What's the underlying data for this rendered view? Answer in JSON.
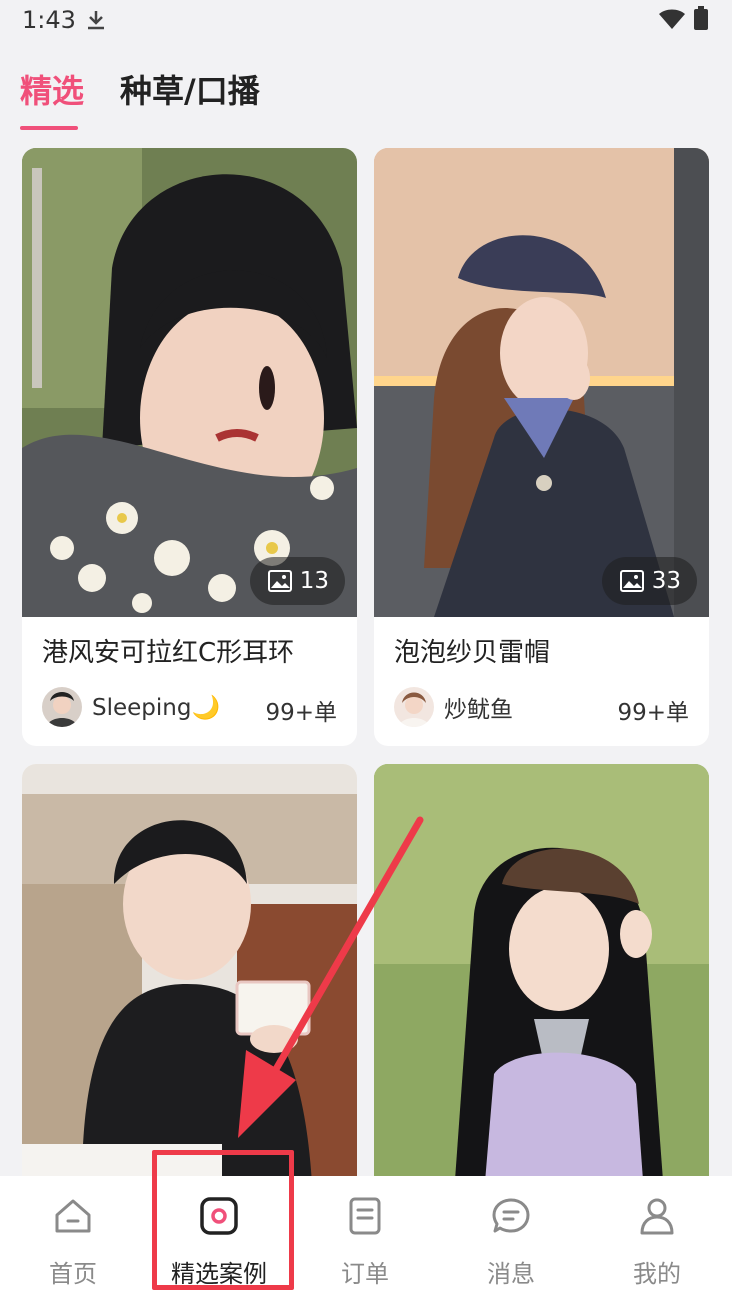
{
  "status_bar": {
    "time": "1:43"
  },
  "tabs": [
    {
      "label": "精选",
      "active": true
    },
    {
      "label": "种草/口播",
      "active": false
    }
  ],
  "cards": [
    {
      "title": "港风安可拉红C形耳环",
      "author": "Sleeping🌙",
      "orders": "99+单",
      "photo_count": "13"
    },
    {
      "title": "泡泡纱贝雷帽",
      "author": "炒鱿鱼",
      "orders": "99+单",
      "photo_count": "33"
    },
    {
      "title": "",
      "author": "",
      "orders": "",
      "photo_count": ""
    },
    {
      "title": "",
      "author": "",
      "orders": "",
      "photo_count": ""
    }
  ],
  "nav": {
    "items": [
      {
        "label": "首页",
        "icon": "home-icon"
      },
      {
        "label": "精选案例",
        "icon": "featured-cases-icon",
        "active": true
      },
      {
        "label": "订单",
        "icon": "order-icon"
      },
      {
        "label": "消息",
        "icon": "message-icon"
      },
      {
        "label": "我的",
        "icon": "profile-icon"
      }
    ]
  },
  "colors": {
    "accent": "#f0507a",
    "highlight": "#ee3a49",
    "background": "#f2f2f4"
  }
}
